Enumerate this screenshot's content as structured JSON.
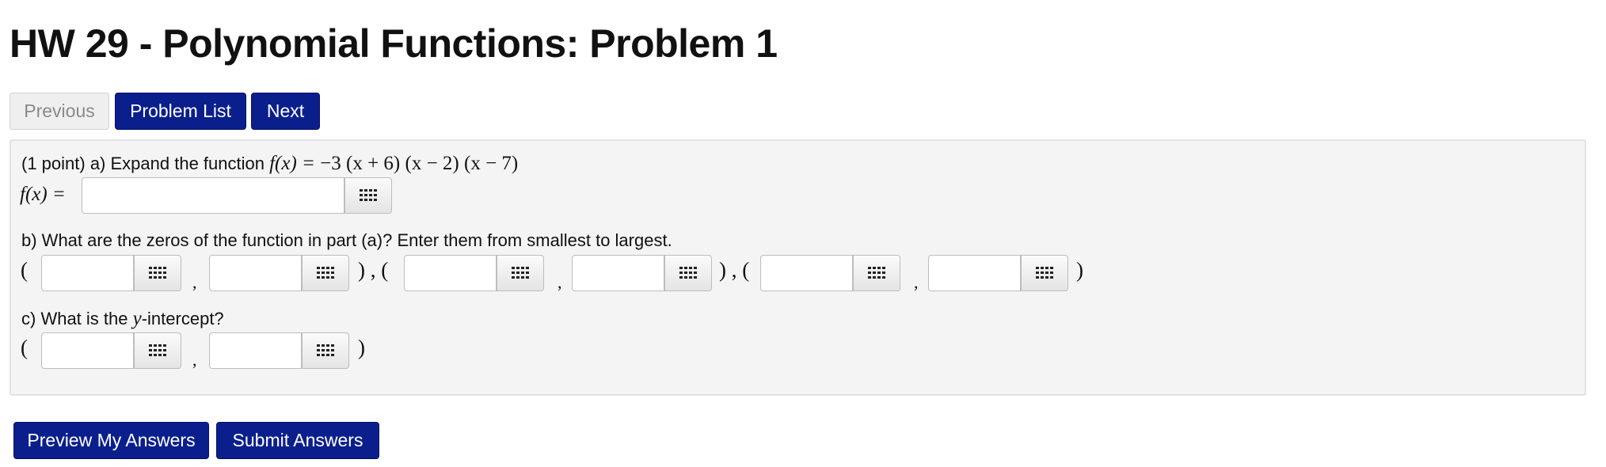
{
  "page": {
    "title": "HW 29 - Polynomial Functions: Problem 1"
  },
  "nav": {
    "previous": "Previous",
    "problem_list": "Problem List",
    "next": "Next"
  },
  "problem": {
    "part_a": {
      "prefix": "(1 point) a) Expand the function",
      "function_lhs": "f(x) = ",
      "function_rhs": "−3 (x + 6) (x − 2) (x − 7)",
      "answer_label": "f(x) =",
      "answer_eq": "=",
      "answer_value": ""
    },
    "part_b": {
      "prompt": "b) What are the zeros of the function in part (a)? Enter them from smallest to largest.",
      "open": "(",
      "comma": ",",
      "between": ") , (",
      "close": ")",
      "zeros": [
        {
          "x": "",
          "y": ""
        },
        {
          "x": "",
          "y": ""
        },
        {
          "x": "",
          "y": ""
        }
      ]
    },
    "part_c": {
      "prompt_before": "c) What is the",
      "var": "y",
      "prompt_after": "-intercept?",
      "open": "(",
      "comma": ",",
      "close": ")",
      "x": "",
      "y": ""
    }
  },
  "actions": {
    "preview": "Preview My Answers",
    "submit": "Submit Answers"
  },
  "icons": {
    "equation_editor": "keypad-grid-icon"
  },
  "colors": {
    "primary_button": "#0b1f8c",
    "panel_background": "#f4f4f4",
    "disabled_button": "#efefef"
  }
}
